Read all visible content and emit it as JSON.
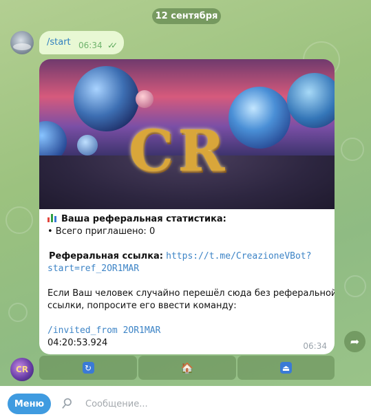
{
  "date_pill": "12 сентября",
  "outgoing": {
    "text": "/start",
    "time": "06:34",
    "status_icon": "double-check-icon"
  },
  "bot_message": {
    "image_text": "CR",
    "stats_title": "Ваша реферальная статистика:",
    "invited_line": "• Всего приглашено: 0",
    "ref_label": "Реферальная ссылка:",
    "ref_link_line1": "https://t.me/CreazioneVBot?",
    "ref_link_line2": "start=ref_2OR1MAR",
    "help_line1": "Если Ваш человек случайно перешёл сюда без реферальной",
    "help_line2": "ссылки, попросите его ввести команду:",
    "command": "/invited_from 2OR1MAR",
    "timestamp": "04:20:53.924",
    "time": "06:34"
  },
  "bot_avatar_text": "CR",
  "keyboard": [
    {
      "icon": "refresh-icon",
      "glyph": "🔄"
    },
    {
      "icon": "home-icon",
      "glyph": "🏠"
    },
    {
      "icon": "eject-icon",
      "glyph": "⏏"
    }
  ],
  "input_bar": {
    "menu_label": "Меню",
    "placeholder": "Сообщение..."
  },
  "colors": {
    "accent": "#3f9be0",
    "link": "#3d84c6",
    "outgoing_bubble": "#e8f8d4",
    "wallpaper": "#9cc27f"
  }
}
